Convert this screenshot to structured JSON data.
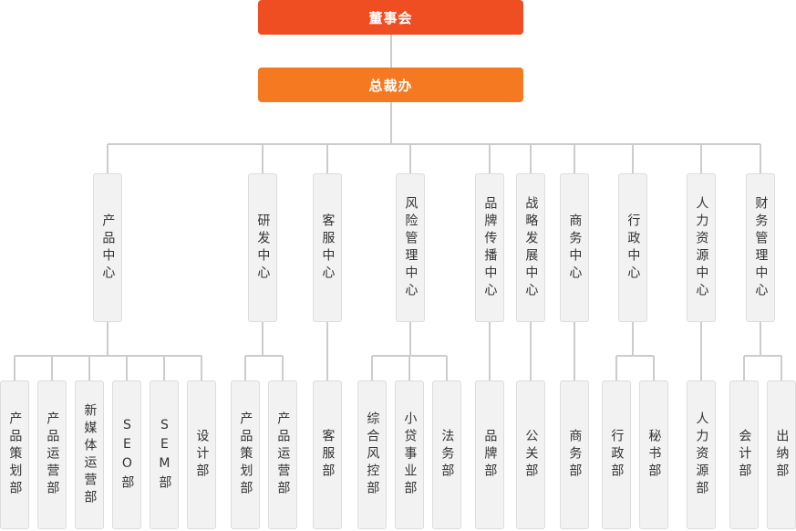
{
  "top": {
    "board": "董事会",
    "ceo_office": "总裁办"
  },
  "centers": [
    "产品中心",
    "研发中心",
    "客服中心",
    "风险管理中心",
    "品牌传播中心",
    "战略发展中心",
    "商务中心",
    "行政中心",
    "人力资源中心",
    "财务管理中心"
  ],
  "departments": [
    "产品策划部",
    "产品运营部",
    "新媒体运营部",
    "SEO部",
    "SEM部",
    "设计部",
    "产品策划部",
    "产品运营部",
    "客服部",
    "综合风控部",
    "小贷事业部",
    "法务部",
    "品牌部",
    "公关部",
    "商务部",
    "行政部",
    "秘书部",
    "人力资源部",
    "会计部",
    "出纳部"
  ],
  "colors": {
    "board": "#ef4e23",
    "ceo_office": "#f47920",
    "line": "#cccccc",
    "box_fill": "#f2f2f2",
    "box_border": "#dddddd"
  }
}
